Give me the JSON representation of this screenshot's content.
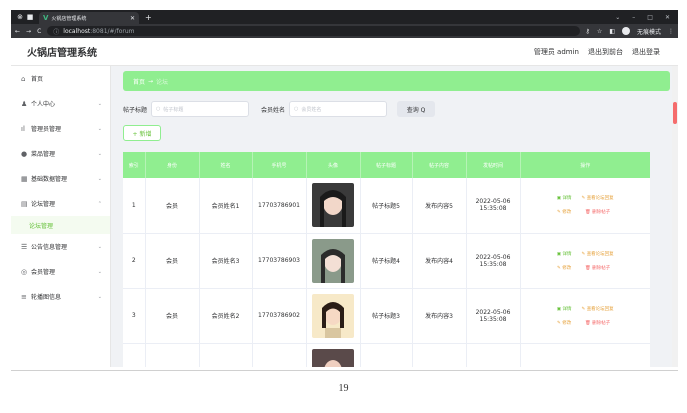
{
  "browser": {
    "tab_title": "火锅店管理系统",
    "url_host": "localhost",
    "url_path": ":8081/#/forum",
    "incognito_label": "无痕模式"
  },
  "header": {
    "title": "火锅店管理系统",
    "user": "管理员 admin",
    "to_front": "退出到前台",
    "logout": "退出登录"
  },
  "sidebar": {
    "items": [
      {
        "label": "首页",
        "icon": "home-icon",
        "chev": false
      },
      {
        "label": "个人中心",
        "icon": "user-icon",
        "chev": true
      },
      {
        "label": "管理员管理",
        "icon": "bar-chart-icon",
        "chev": true
      },
      {
        "label": "菜品管理",
        "icon": "pin-icon",
        "chev": true
      },
      {
        "label": "基础数据管理",
        "icon": "grid-icon",
        "chev": true
      },
      {
        "label": "论坛管理",
        "icon": "doc-icon",
        "chev": true,
        "open": true
      },
      {
        "label": "公告信息管理",
        "icon": "list-icon",
        "chev": true
      },
      {
        "label": "会员管理",
        "icon": "badge-icon",
        "chev": true
      },
      {
        "label": "轮播图信息",
        "icon": "menu-icon",
        "chev": true
      }
    ],
    "sub_active": "论坛管理"
  },
  "breadcrumb": {
    "home": "首页",
    "sep": "→",
    "current": "论坛"
  },
  "search": {
    "label1": "帖子标题",
    "placeholder1": "帖子标题",
    "label2": "会员姓名",
    "placeholder2": "会员姓名",
    "query_btn": "查询 Q"
  },
  "add_btn": "+ 新增",
  "table": {
    "headers": [
      "索引",
      "身份",
      "姓名",
      "手机号",
      "头像",
      "帖子标题",
      "帖子内容",
      "发帖时间",
      "操作"
    ],
    "rows": [
      {
        "index": "1",
        "role": "会员",
        "name": "会员姓名1",
        "phone": "17703786901",
        "title": "帖子标题5",
        "content": "发布内容5",
        "time": "2022-05-06 15:35:08"
      },
      {
        "index": "2",
        "role": "会员",
        "name": "会员姓名3",
        "phone": "17703786903",
        "title": "帖子标题4",
        "content": "发布内容4",
        "time": "2022-05-06 15:35:08"
      },
      {
        "index": "3",
        "role": "会员",
        "name": "会员姓名2",
        "phone": "17703786902",
        "title": "帖子标题3",
        "content": "发布内容3",
        "time": "2022-05-06 15:35:08"
      }
    ],
    "ops": {
      "detail": "详情",
      "forum_reply": "查看论坛回复",
      "edit": "修改",
      "delete": "删除帖子"
    }
  },
  "footer_page": "19"
}
